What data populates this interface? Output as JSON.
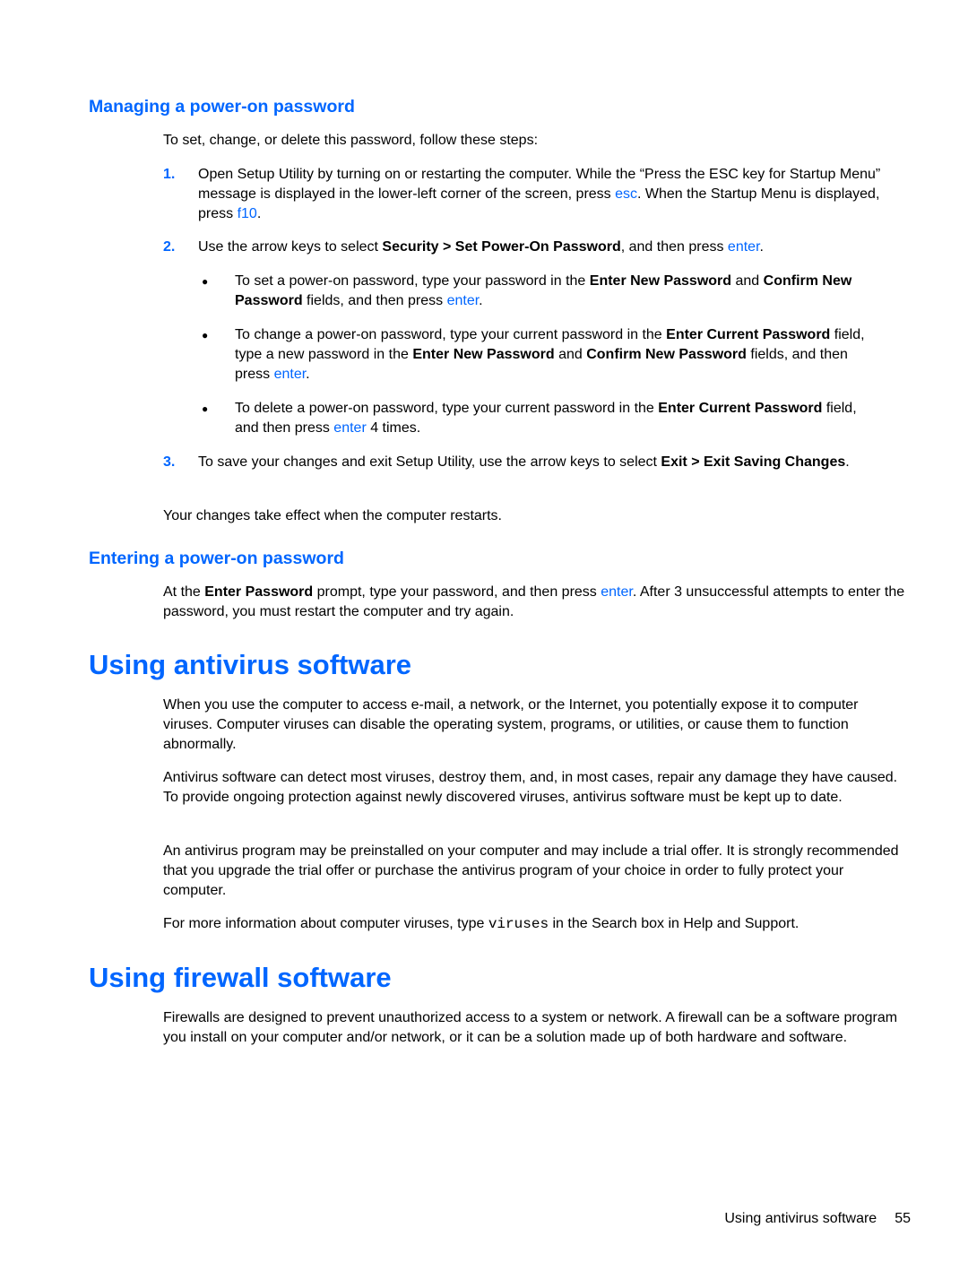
{
  "sections": {
    "managing": {
      "heading": "Managing a power-on password",
      "intro": "To set, change, or delete this password, follow these steps:",
      "steps": [
        {
          "num": "1.",
          "runs": [
            {
              "t": "Open Setup Utility by turning on or restarting the computer. While the “Press the ESC key for Startup Menu” message is displayed in the lower-left corner of the screen, press "
            },
            {
              "t": "esc",
              "s": "key"
            },
            {
              "t": ". When the Startup Menu is displayed, press "
            },
            {
              "t": "f10",
              "s": "key"
            },
            {
              "t": "."
            }
          ]
        },
        {
          "num": "2.",
          "runs": [
            {
              "t": "Use the arrow keys to select "
            },
            {
              "t": "Security > Set Power-On Password",
              "s": "bold"
            },
            {
              "t": ", and then press "
            },
            {
              "t": "enter",
              "s": "key"
            },
            {
              "t": "."
            }
          ]
        },
        {
          "num": "3.",
          "runs": [
            {
              "t": "To save your changes and exit Setup Utility, use the arrow keys to select "
            },
            {
              "t": "Exit > Exit Saving Changes",
              "s": "bold"
            },
            {
              "t": "."
            }
          ]
        }
      ],
      "bullets": [
        {
          "runs": [
            {
              "t": "To set a power-on password, type your password in the "
            },
            {
              "t": "Enter New Password",
              "s": "bold"
            },
            {
              "t": " and "
            },
            {
              "t": "Confirm New Password",
              "s": "bold"
            },
            {
              "t": " fields, and then press "
            },
            {
              "t": "enter",
              "s": "key"
            },
            {
              "t": "."
            }
          ]
        },
        {
          "runs": [
            {
              "t": "To change a power-on password, type your current password in the "
            },
            {
              "t": "Enter Current Password",
              "s": "bold"
            },
            {
              "t": " field, type a new password in the "
            },
            {
              "t": "Enter New Password",
              "s": "bold"
            },
            {
              "t": " and "
            },
            {
              "t": "Confirm New Password",
              "s": "bold"
            },
            {
              "t": " fields, and then press "
            },
            {
              "t": "enter",
              "s": "key"
            },
            {
              "t": "."
            }
          ]
        },
        {
          "runs": [
            {
              "t": "To delete a power-on password, type your current password in the "
            },
            {
              "t": "Enter Current Password",
              "s": "bold"
            },
            {
              "t": " field, and then press "
            },
            {
              "t": "enter",
              "s": "key"
            },
            {
              "t": " 4 times."
            }
          ]
        }
      ],
      "bullet_glyph": "●",
      "outro": "Your changes take effect when the computer restarts."
    },
    "entering": {
      "heading": "Entering a power-on password",
      "runs": [
        {
          "t": "At the "
        },
        {
          "t": "Enter Password",
          "s": "bold"
        },
        {
          "t": " prompt, type your password, and then press "
        },
        {
          "t": "enter",
          "s": "key"
        },
        {
          "t": ". After 3 unsuccessful attempts to enter the password, you must restart the computer and try again."
        }
      ]
    },
    "antivirus": {
      "heading": "Using antivirus software",
      "paragraphs": [
        [
          {
            "t": "When you use the computer to access e-mail, a network, or the Internet, you potentially expose it to computer viruses. Computer viruses can disable the operating system, programs, or utilities, or cause them to function abnormally."
          }
        ],
        [
          {
            "t": "Antivirus software can detect most viruses, destroy them, and, in most cases, repair any damage they have caused. To provide ongoing protection against newly discovered viruses, antivirus software must be kept up to date."
          }
        ],
        [
          {
            "t": "An antivirus program may be preinstalled on your computer and may include a trial offer. It is strongly recommended that you upgrade the trial offer or purchase the antivirus program of your choice in order to fully protect your computer."
          }
        ],
        [
          {
            "t": "For more information about computer viruses, type "
          },
          {
            "t": "viruses",
            "s": "mono"
          },
          {
            "t": " in the Search box in Help and Support."
          }
        ]
      ]
    },
    "firewall": {
      "heading": "Using firewall software",
      "paragraphs": [
        [
          {
            "t": "Firewalls are designed to prevent unauthorized access to a system or network. A firewall can be a software program you install on your computer and/or network, or it can be a solution made up of both hardware and software."
          }
        ]
      ]
    }
  },
  "footer": {
    "section_title": "Using antivirus software",
    "page_number": "55"
  },
  "colors": {
    "heading": "#0066ff",
    "key": "#0066ff",
    "text": "#000000"
  }
}
